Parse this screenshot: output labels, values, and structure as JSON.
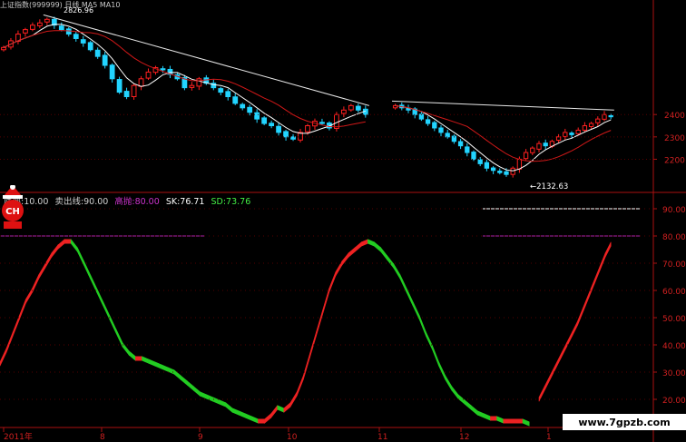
{
  "chart_data": [
    {
      "type": "candlestick",
      "panel": "price",
      "annotations": {
        "high_label": "2826.96",
        "low_label": "←2132.63"
      },
      "y_tick_labels": [
        "2400",
        "2300",
        "2200"
      ],
      "ylim": [
        2080,
        2880
      ],
      "colors": {
        "up": "#ff2020",
        "down": "#22d4ff",
        "ma_short": "#ffffff",
        "ma_long": "#d01818",
        "trendline": "#e8e8e8"
      },
      "segments": [
        {
          "x_from": 0,
          "x_to": 0.565,
          "closes": [
            2700,
            2730,
            2760,
            2780,
            2800,
            2810,
            2826,
            2800,
            2780,
            2760,
            2740,
            2720,
            2690,
            2660,
            2620,
            2560,
            2500,
            2480,
            2530,
            2560,
            2590,
            2610,
            2600,
            2580,
            2560,
            2520,
            2530,
            2560,
            2540,
            2520,
            2500,
            2480,
            2450,
            2430,
            2410,
            2380,
            2360,
            2350,
            2320,
            2300,
            2290,
            2320,
            2350,
            2370,
            2360,
            2340,
            2400,
            2420,
            2440,
            2420,
            2400
          ]
        },
        {
          "x_from": 0.6,
          "x_to": 0.94,
          "closes": [
            2440,
            2430,
            2420,
            2400,
            2380,
            2360,
            2340,
            2320,
            2300,
            2280,
            2260,
            2230,
            2200,
            2180,
            2160,
            2150,
            2140,
            2132,
            2160,
            2200,
            2230,
            2250,
            2270,
            2260,
            2280,
            2300,
            2320,
            2310,
            2330,
            2350,
            2360,
            2380,
            2400,
            2390
          ]
        }
      ]
    },
    {
      "type": "line",
      "panel": "indicator",
      "legend": [
        {
          "label": "底部:10.00",
          "color": "#d0d0d0"
        },
        {
          "label": "卖出线:90.00",
          "color": "#d0d0d0"
        },
        {
          "label": "高抛:80.00",
          "color": "#cc33cc"
        },
        {
          "label": "SK:76.71",
          "color": "#ffffff"
        },
        {
          "label": "SD:73.76",
          "color": "#44ee44"
        }
      ],
      "y_tick_labels": [
        "90.00",
        "80.00",
        "70.00",
        "60.00",
        "50.00",
        "40.00",
        "30.00",
        "20.00"
      ],
      "ylim": [
        10,
        95
      ],
      "reference_lines": [
        {
          "name": "卖出线",
          "value": 90,
          "color": "#ffffff"
        },
        {
          "name": "高抛",
          "value": 80,
          "color": "#aa22aa"
        }
      ],
      "x_tick_labels": [
        "2011年",
        "8",
        "9",
        "10",
        "11",
        "12",
        "1"
      ],
      "segments": [
        {
          "x_from": 0,
          "x_to": 0.81,
          "values": [
            33,
            38,
            44,
            50,
            56,
            60,
            65,
            69,
            73,
            76,
            78,
            78,
            75,
            70,
            65,
            60,
            55,
            50,
            45,
            40,
            37,
            35,
            35,
            34,
            33,
            32,
            31,
            30,
            28,
            26,
            24,
            22,
            21,
            20,
            19,
            18,
            16,
            15,
            14,
            13,
            12,
            12,
            14,
            17,
            16,
            18,
            22,
            28,
            36,
            44,
            52,
            60,
            66,
            70,
            73,
            75,
            77,
            78,
            77,
            75,
            72,
            69,
            65,
            60,
            55,
            50,
            44,
            39,
            33,
            28,
            24,
            21,
            19,
            17,
            15,
            14,
            13,
            13,
            12,
            12,
            12,
            12,
            11
          ]
        },
        {
          "x_from": 0.825,
          "x_to": 0.935,
          "values": [
            20,
            24,
            28,
            32,
            36,
            40,
            44,
            48,
            53,
            58,
            63,
            68,
            73,
            77
          ]
        }
      ],
      "rising_color": "#ee2222",
      "falling_color": "#22cc22"
    }
  ],
  "header_text": "上证指数(999999) 日线 MA5 MA10",
  "watermark": "www.7gpzb.com",
  "badge_text": "CH"
}
